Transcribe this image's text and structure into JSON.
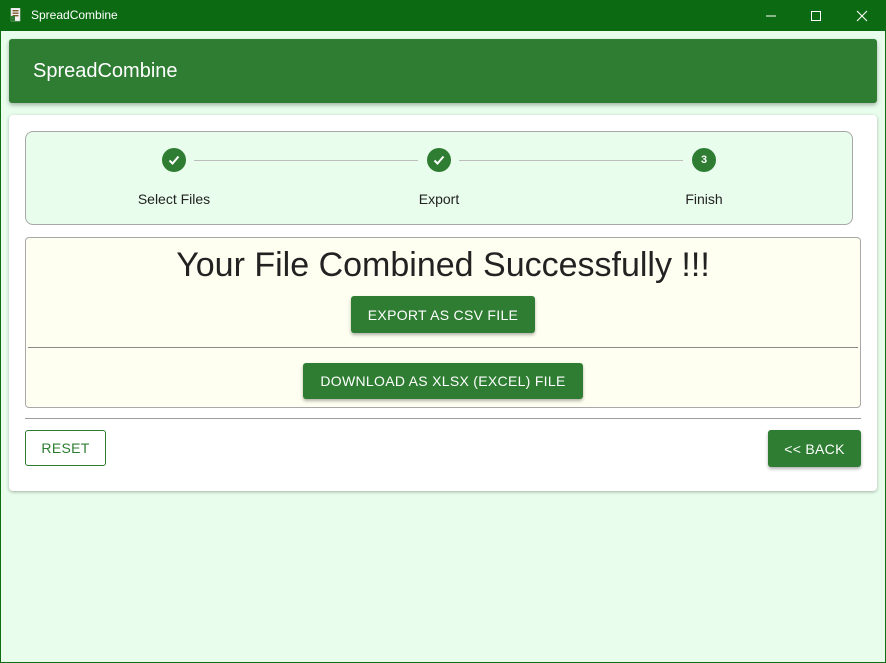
{
  "window": {
    "title": "SpreadCombine",
    "controls": [
      "minimize-icon",
      "maximize-icon",
      "close-icon"
    ]
  },
  "appbar": {
    "title": "SpreadCombine"
  },
  "stepper": {
    "steps": [
      {
        "label": "Select Files",
        "state": "completed",
        "indicator": "check-icon"
      },
      {
        "label": "Export",
        "state": "completed",
        "indicator": "check-icon"
      },
      {
        "label": "Finish",
        "state": "active",
        "number": "3"
      }
    ]
  },
  "result": {
    "title": "Your File Combined Successfully !!!",
    "export_csv_label": "EXPORT AS CSV FILE",
    "download_xlsx_label": "DOWNLOAD AS XLSX (EXCEL) FILE"
  },
  "actions": {
    "reset_label": "RESET",
    "back_label": "<< BACK"
  },
  "colors": {
    "titlebar": "#0c6b12",
    "primary": "#2e7d32",
    "background": "#e8fdec",
    "result_bg": "#fefff0"
  }
}
